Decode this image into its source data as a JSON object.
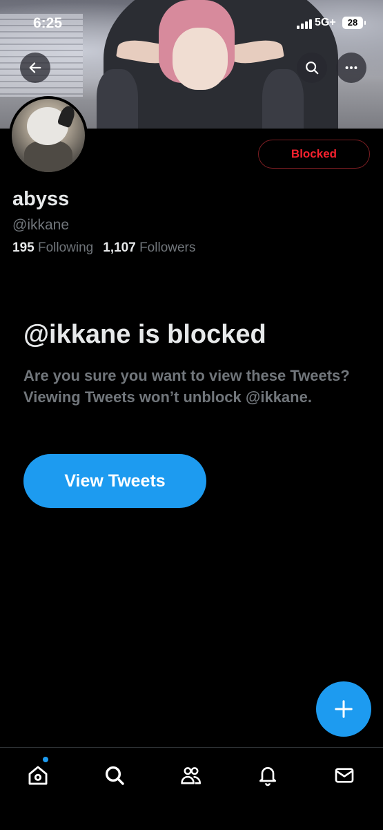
{
  "status_bar": {
    "time": "6:25",
    "network": "5G+",
    "battery": "28"
  },
  "profile": {
    "name": "abyss",
    "handle": "@ikkane",
    "following_count": "195",
    "following_label": "Following",
    "followers_count": "1,107",
    "followers_label": "Followers",
    "blocked_button_label": "Blocked"
  },
  "blocked_notice": {
    "title": "@ikkane is blocked",
    "description": "Are you sure you want to view these Tweets? Viewing Tweets won’t unblock @ikkane.",
    "view_button_label": "View Tweets"
  },
  "header_icons": [
    "back-arrow-icon",
    "search-icon",
    "more-icon"
  ],
  "tab_bar": [
    {
      "icon": "home-icon",
      "has_notification_dot": true
    },
    {
      "icon": "search-icon"
    },
    {
      "icon": "communities-icon"
    },
    {
      "icon": "bell-icon"
    },
    {
      "icon": "mail-icon"
    }
  ],
  "colors": {
    "background": "#000000",
    "accent": "#1d9bf0",
    "blocked_red": "#f4212e",
    "secondary_text": "#71767b",
    "primary_text": "#e7e9ea"
  }
}
